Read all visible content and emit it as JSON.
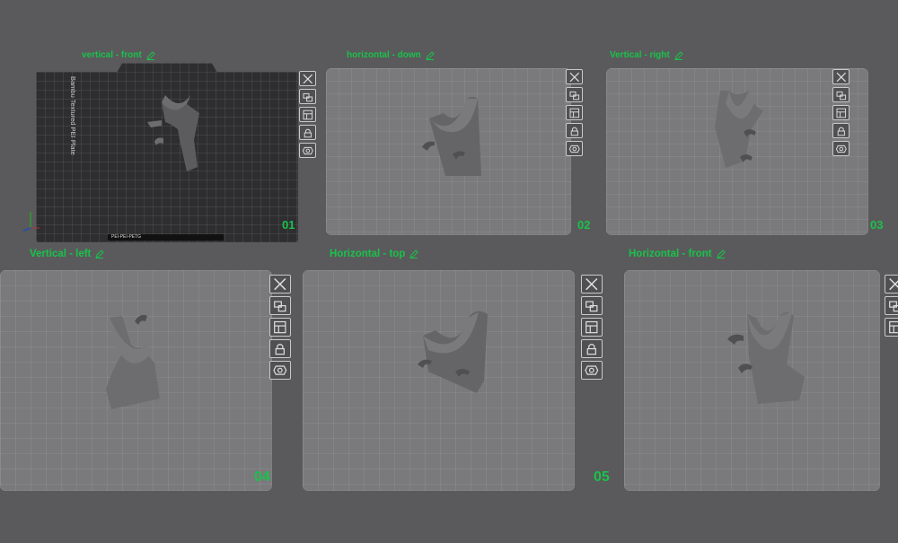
{
  "plates": [
    {
      "name": "vertical - front",
      "number": "01",
      "bed_label": "Bambu Textured PEI Plate",
      "strip_label": "PEI-PEI-PETG"
    },
    {
      "name": "horizontal - down",
      "number": "02"
    },
    {
      "name": "Vertical - right",
      "number": "03"
    },
    {
      "name": "Vertical - left",
      "number": "04"
    },
    {
      "name": "Horizontal - top",
      "number": "05"
    },
    {
      "name": "Horizontal - front",
      "number": ""
    }
  ],
  "tools": [
    "close-icon",
    "arrange-icon",
    "layout-icon",
    "lock-icon",
    "settings-icon"
  ],
  "colors": {
    "label_green": "#19c24a",
    "plate": "#7a7a7c",
    "active_plate": "#2e2e30",
    "model": "#6b6b6d"
  }
}
